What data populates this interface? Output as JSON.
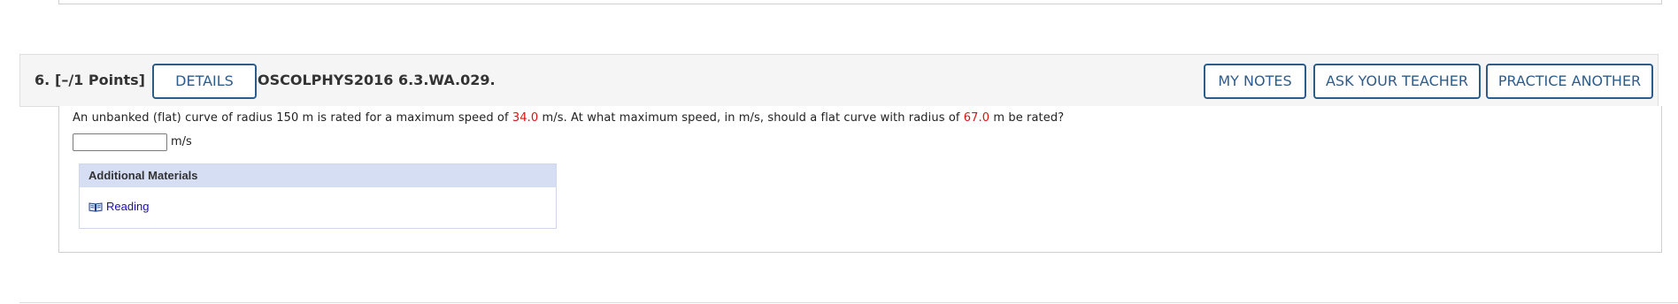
{
  "question": {
    "number": "6.",
    "points": "[–/1 Points]",
    "details_label": "DETAILS",
    "code": "OSCOLPHYS2016 6.3.WA.029.",
    "my_notes_label": "MY NOTES",
    "ask_teacher_label": "ASK YOUR TEACHER",
    "practice_another_label": "PRACTICE ANOTHER"
  },
  "prompt": {
    "part1": "An unbanked (flat) curve of radius 150 m is rated for a maximum speed of ",
    "value1": "34.0",
    "part2": " m/s. At what maximum speed, in m/s, should a flat curve with radius of ",
    "value2": "67.0",
    "part3": " m be rated?"
  },
  "answer": {
    "value": "",
    "unit": "m/s"
  },
  "additional_materials": {
    "heading": "Additional Materials",
    "items": [
      {
        "label": "Reading",
        "icon": "book-icon"
      }
    ]
  },
  "colors": {
    "button_border": "#2d5c8b",
    "highlight_value": "#dd1111",
    "materials_header": "#d6def4",
    "link": "#1a0dab"
  }
}
